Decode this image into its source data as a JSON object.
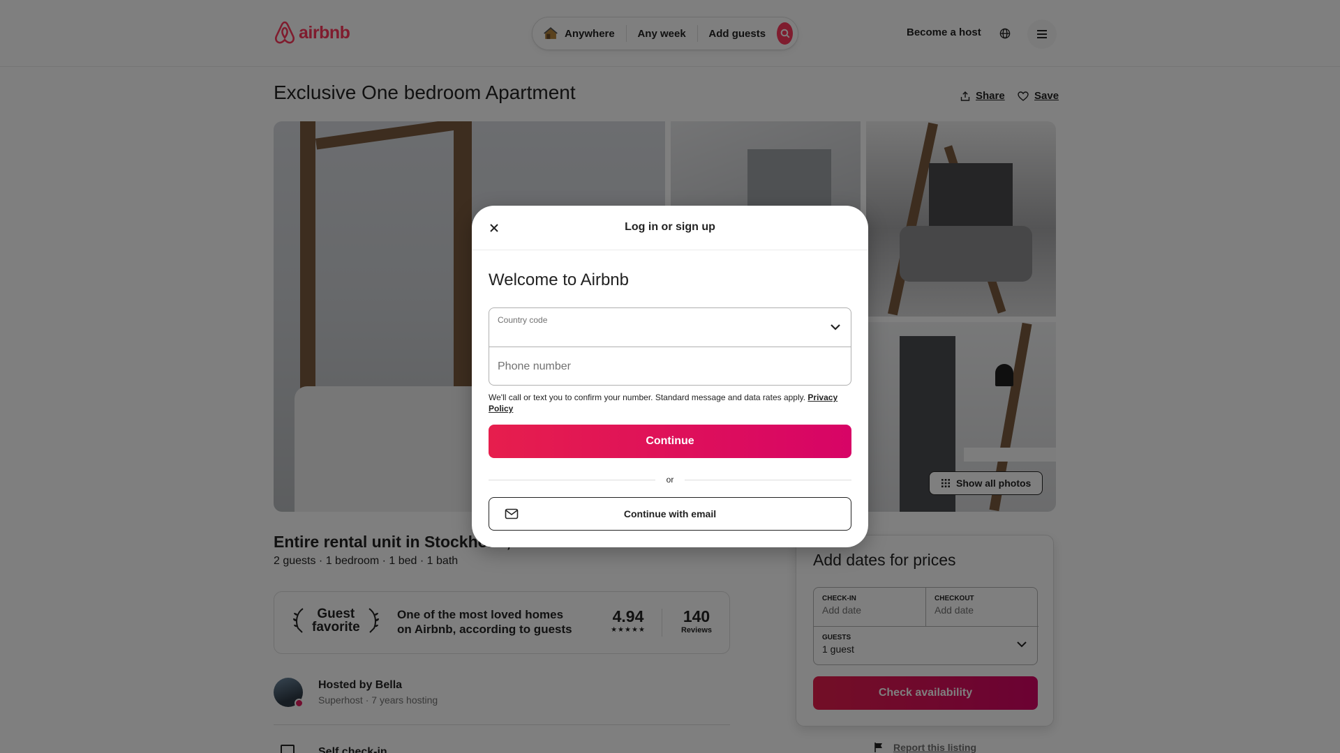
{
  "brand": {
    "name": "airbnb",
    "color": "#ff385c"
  },
  "search": {
    "location": "Anywhere",
    "week": "Any week",
    "guests": "Add guests"
  },
  "header": {
    "become_host": "Become a host"
  },
  "listing": {
    "title": "Exclusive One bedroom Apartment",
    "share": "Share",
    "save": "Save",
    "show_all_photos": "Show all photos",
    "subtitle": "Entire rental unit in Stockholm, Sweden",
    "specs": "2 guests · 1 bedroom · 1 bed · 1 bath"
  },
  "guest_favorite": {
    "badge_line1": "Guest",
    "badge_line2": "favorite",
    "description": "One of the most loved homes on Airbnb, according to guests",
    "rating": "4.94",
    "stars": 5,
    "reviews_count": "140",
    "reviews_label": "Reviews"
  },
  "host": {
    "name": "Hosted by Bella",
    "meta": "Superhost · 7 years hosting"
  },
  "highlight": {
    "self_checkin": "Self check-in"
  },
  "booking": {
    "title": "Add dates for prices",
    "checkin_label": "CHECK-IN",
    "checkin_value": "Add date",
    "checkout_label": "CHECKOUT",
    "checkout_value": "Add date",
    "guests_label": "GUESTS",
    "guests_value": "1 guest",
    "button": "Check availability",
    "report": "Report this listing"
  },
  "modal": {
    "title": "Log in or sign up",
    "welcome": "Welcome to Airbnb",
    "country_code_label": "Country code",
    "phone_placeholder": "Phone number",
    "disclaimer": "We'll call or text you to confirm your number. Standard message and data rates apply. ",
    "privacy_link": "Privacy Policy",
    "continue": "Continue",
    "or": "or",
    "email_button": "Continue with email",
    "accent": "#e61e4d"
  }
}
